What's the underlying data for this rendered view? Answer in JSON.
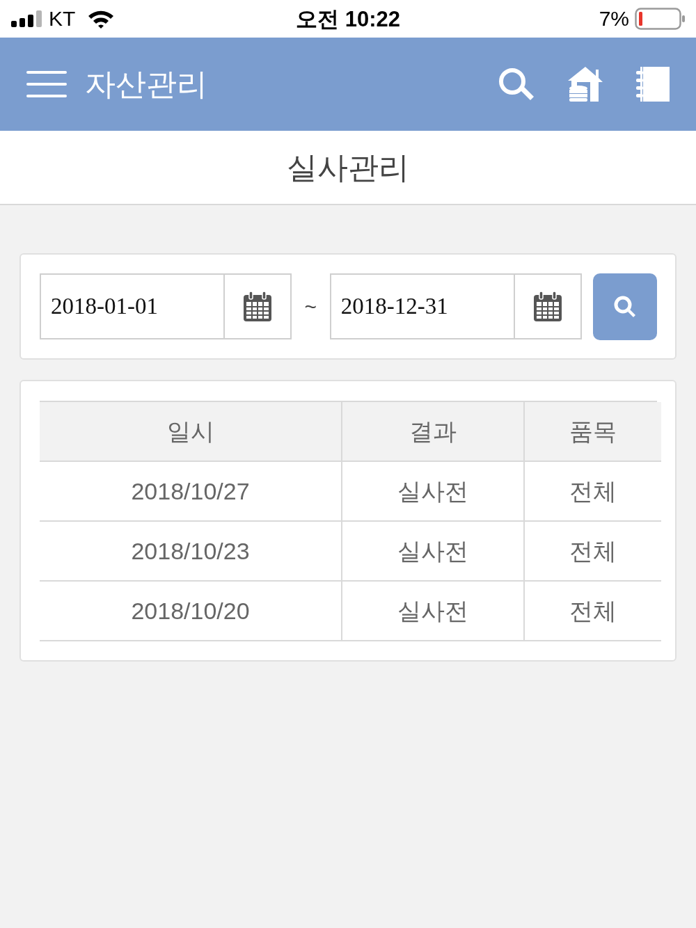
{
  "status_bar": {
    "carrier": "KT",
    "time": "오전 10:22",
    "battery": "7%"
  },
  "header": {
    "title": "자산관리"
  },
  "page_title": "실사관리",
  "search": {
    "start_date": "2018-01-01",
    "separator": "~",
    "end_date": "2018-12-31"
  },
  "table": {
    "columns": [
      "일시",
      "결과",
      "품목"
    ],
    "rows": [
      [
        "2018/10/27",
        "실사전",
        "전체"
      ],
      [
        "2018/10/23",
        "실사전",
        "전체"
      ],
      [
        "2018/10/20",
        "실사전",
        "전체"
      ]
    ]
  }
}
